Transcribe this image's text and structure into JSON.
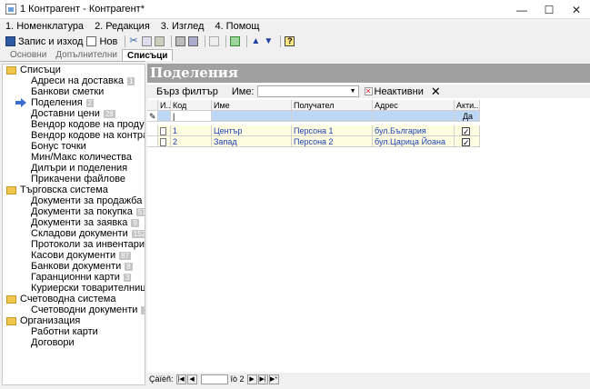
{
  "window": {
    "title": "1 Контрагент - Контрагент*"
  },
  "menu": [
    "1. Номенклатура",
    "2. Редакция",
    "3. Изглед",
    "4. Помощ"
  ],
  "toolbar": {
    "save_label": "Запис и изход",
    "new_label": "Нов"
  },
  "tabs": [
    "Основни",
    "Допълнителни",
    "Списъци"
  ],
  "tree": [
    {
      "label": "Списъци",
      "items": [
        {
          "label": "Адреси на доставка",
          "badge": "1"
        },
        {
          "label": "Банкови сметки",
          "badge": ""
        },
        {
          "label": "Поделения",
          "badge": "2",
          "selected": true
        },
        {
          "label": "Доставни цени",
          "badge": "28"
        },
        {
          "label": "Вендор кодове на продукти",
          "badge": "1"
        },
        {
          "label": "Вендор кодове на контрагенти",
          "badge": ""
        },
        {
          "label": "Бонус точки",
          "badge": ""
        },
        {
          "label": "Мин/Макс количества",
          "badge": ""
        },
        {
          "label": "Дилъри и поделения",
          "badge": ""
        },
        {
          "label": "Прикачени файлове",
          "badge": ""
        }
      ]
    },
    {
      "label": "Търговска система",
      "items": [
        {
          "label": "Документи за продажба",
          "badge": "265"
        },
        {
          "label": "Документи за покупка",
          "badge": "51"
        },
        {
          "label": "Документи за заявка",
          "badge": "9"
        },
        {
          "label": "Складови документи",
          "badge": "152"
        },
        {
          "label": "Протоколи за инвентаризация",
          "badge": ""
        },
        {
          "label": "Касови документи",
          "badge": "87"
        },
        {
          "label": "Банкови документи",
          "badge": "8"
        },
        {
          "label": "Гаранционни карти",
          "badge": "3"
        },
        {
          "label": "Куриерски товарителници",
          "badge": ""
        }
      ]
    },
    {
      "label": "Счетоводна система",
      "items": [
        {
          "label": "Счетоводни документи",
          "badge": "159"
        }
      ]
    },
    {
      "label": "Организация",
      "items": [
        {
          "label": "Работни карти",
          "badge": ""
        },
        {
          "label": "Договори",
          "badge": ""
        }
      ]
    }
  ],
  "main": {
    "header": "Поделения",
    "filter_label": "Бърз филтър",
    "name_label": "Име:",
    "inactive_label": "Неактивни",
    "columns": [
      "И...",
      "Код",
      "Име",
      "Получател",
      "Адрес",
      "Акти..."
    ],
    "new_row_active": "Да",
    "rows": [
      {
        "code": "1",
        "name": "Център",
        "recipient": "Персона 1",
        "address": "бул.България",
        "active": true
      },
      {
        "code": "2",
        "name": "Запад",
        "recipient": "Персона 2",
        "address": "бул.Царица Йоана",
        "active": true
      }
    ],
    "nav": {
      "prefix": "Çàïèñ:",
      "of_label": "îò 2"
    }
  }
}
